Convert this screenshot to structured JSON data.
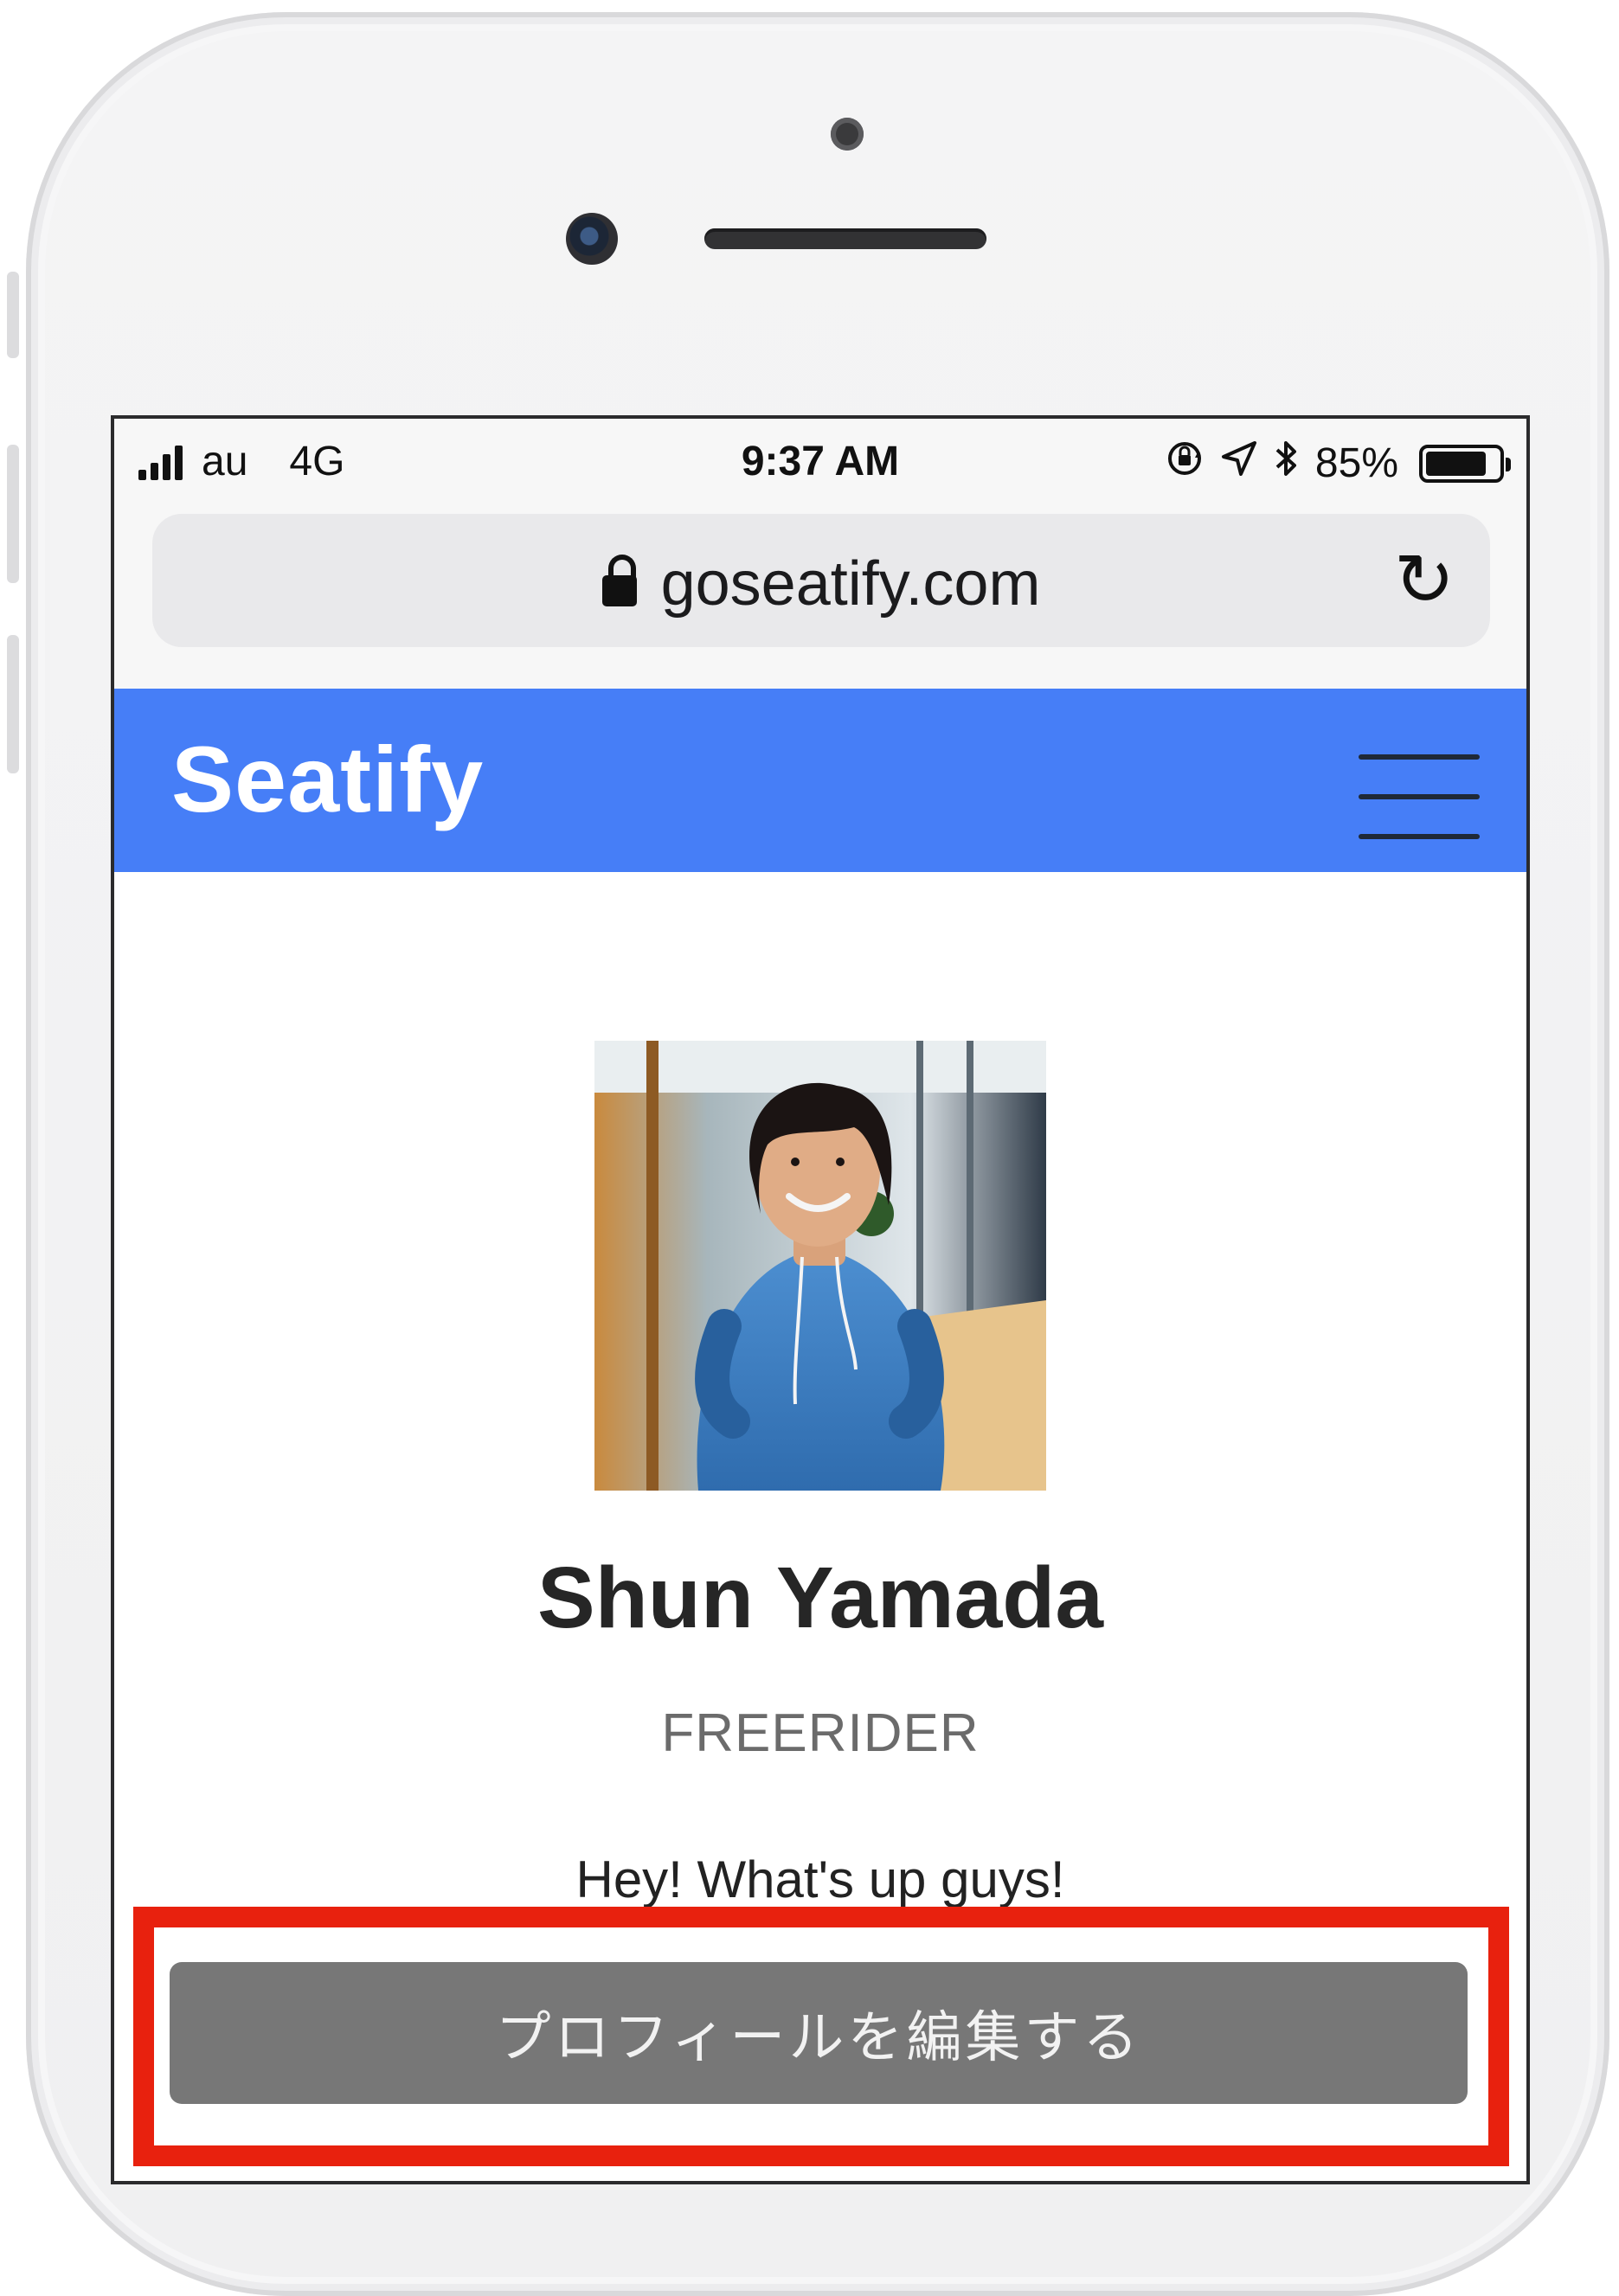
{
  "status_bar": {
    "carrier": "au",
    "network": "4G",
    "time": "9:37 AM",
    "battery_percent": "85%",
    "battery_level": 0.85,
    "icons": [
      "orientation-lock-icon",
      "location-arrow-icon",
      "bluetooth-icon"
    ]
  },
  "browser": {
    "url": "goseatify.com",
    "reload_glyph": "↻"
  },
  "navbar": {
    "brand": "Seatify",
    "color": "#467ef7"
  },
  "profile": {
    "name": "Shun Yamada",
    "role": "FREERIDER",
    "bio": "Hey! What's up guys!",
    "edit_button_label": "プロフィールを編集する"
  },
  "colors": {
    "highlight_border": "#e8210e",
    "button_background": "#777777"
  }
}
